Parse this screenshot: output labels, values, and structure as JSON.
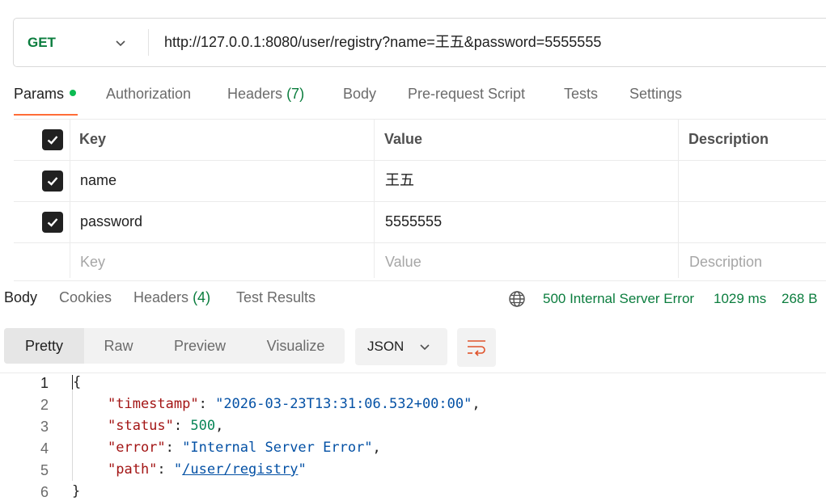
{
  "request": {
    "method": "GET",
    "url": "http://127.0.0.1:8080/user/registry?name=王五&password=5555555"
  },
  "request_tabs": {
    "params": "Params",
    "authorization": "Authorization",
    "headers": "Headers",
    "headers_count": "(7)",
    "body": "Body",
    "prerequest": "Pre-request Script",
    "tests": "Tests",
    "settings": "Settings"
  },
  "params_table": {
    "headers": {
      "key": "Key",
      "value": "Value",
      "description": "Description"
    },
    "rows": [
      {
        "checked": true,
        "key": "name",
        "value": "王五",
        "description": ""
      },
      {
        "checked": true,
        "key": "password",
        "value": "5555555",
        "description": ""
      }
    ],
    "placeholder": {
      "key": "Key",
      "value": "Value",
      "description": "Description"
    }
  },
  "response_tabs": {
    "body": "Body",
    "cookies": "Cookies",
    "headers": "Headers",
    "headers_count": "(4)",
    "test_results": "Test Results"
  },
  "response_status": {
    "status": "500 Internal Server Error",
    "time": "1029 ms",
    "size": "268 B"
  },
  "view_modes": {
    "pretty": "Pretty",
    "raw": "Raw",
    "preview": "Preview",
    "visualize": "Visualize",
    "format": "JSON"
  },
  "response_body": {
    "line_numbers": [
      "1",
      "2",
      "3",
      "4",
      "5",
      "6"
    ],
    "open_brace": "{",
    "close_brace": "}",
    "fields": [
      {
        "key": "\"timestamp\"",
        "value": "\"2026-03-23T13:31:06.532+00:00\""
      },
      {
        "key": "\"status\"",
        "value": "500"
      },
      {
        "key": "\"error\"",
        "value": "\"Internal Server Error\""
      },
      {
        "key": "\"path\"",
        "value": "/user/registry"
      }
    ]
  },
  "colors": {
    "method_get": "#0b7d3e",
    "status_text": "#0b7d3e",
    "active_tab_underline": "#ff6c37",
    "params_dot": "#0cbb52",
    "json_key": "#a31515",
    "json_string": "#0451a5",
    "json_number": "#098658"
  },
  "icons": [
    "chevron-down-icon",
    "checkbox-checked-icon",
    "globe-icon",
    "wrap-lines-icon"
  ]
}
